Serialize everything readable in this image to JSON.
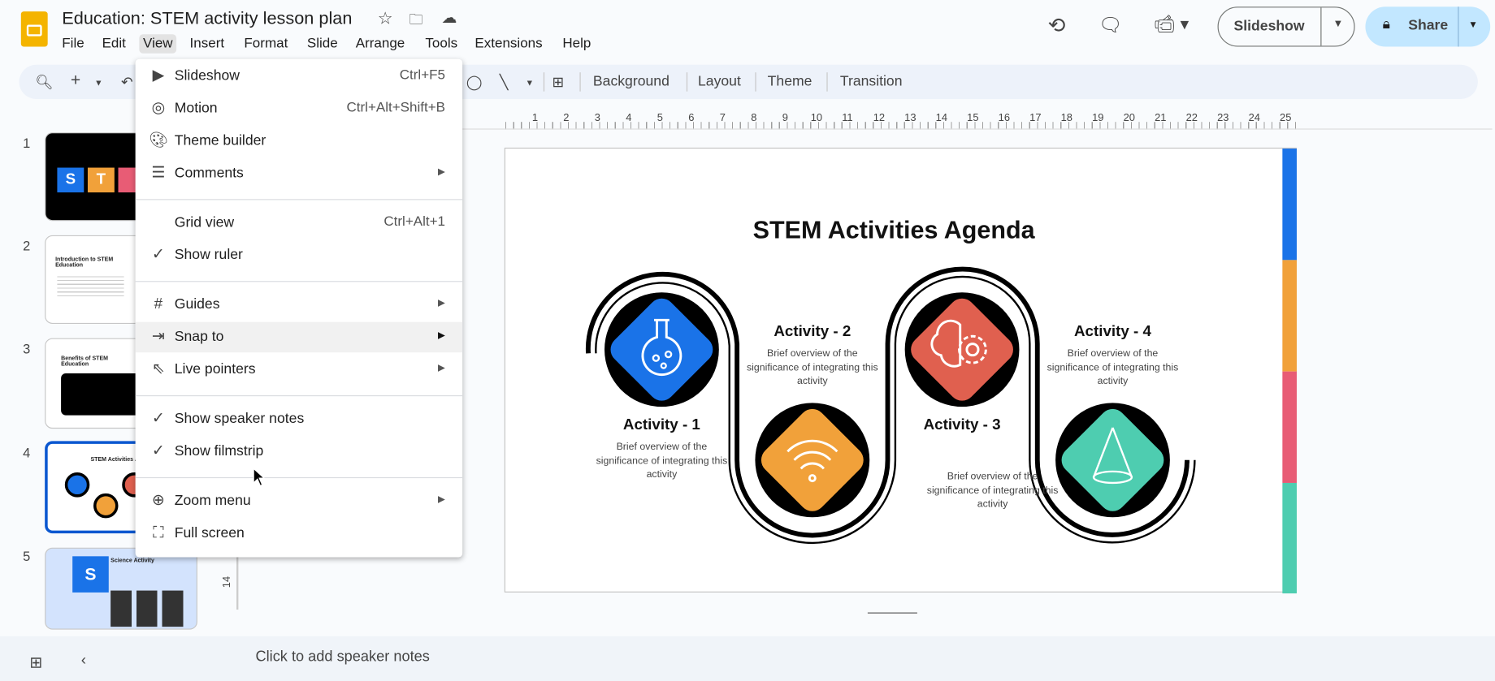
{
  "doc": {
    "title": "Education: STEM activity lesson plan"
  },
  "menubar": [
    "File",
    "Edit",
    "View",
    "Insert",
    "Format",
    "Slide",
    "Arrange",
    "Tools",
    "Extensions",
    "Help"
  ],
  "header": {
    "slideshow_label": "Slideshow",
    "share_label": "Share"
  },
  "toolbar": {
    "background": "Background",
    "layout": "Layout",
    "theme": "Theme",
    "transition": "Transition"
  },
  "view_menu": {
    "slideshow": {
      "label": "Slideshow",
      "shortcut": "Ctrl+F5"
    },
    "motion": {
      "label": "Motion",
      "shortcut": "Ctrl+Alt+Shift+B"
    },
    "theme_builder": {
      "label": "Theme builder"
    },
    "comments": {
      "label": "Comments"
    },
    "grid_view": {
      "label": "Grid view",
      "shortcut": "Ctrl+Alt+1"
    },
    "show_ruler": {
      "label": "Show ruler",
      "checked": true
    },
    "guides": {
      "label": "Guides"
    },
    "snap_to": {
      "label": "Snap to"
    },
    "live_pointers": {
      "label": "Live pointers"
    },
    "speaker_notes": {
      "label": "Show speaker notes",
      "checked": true
    },
    "filmstrip": {
      "label": "Show filmstrip",
      "checked": true
    },
    "zoom_menu": {
      "label": "Zoom menu"
    },
    "full_screen": {
      "label": "Full screen"
    }
  },
  "filmstrip": {
    "numbers": [
      "1",
      "2",
      "3",
      "4",
      "5"
    ],
    "selected": 4,
    "slide2_title": "Introduction to STEM Education",
    "slide3_title": "Benefits of STEM Education",
    "slide5_title": "Science Activity"
  },
  "ruler": {
    "h": [
      "1",
      "2",
      "3",
      "4",
      "5",
      "6",
      "7",
      "8",
      "9",
      "10",
      "11",
      "12",
      "13",
      "14",
      "15",
      "16",
      "17",
      "18",
      "19",
      "20",
      "21",
      "22",
      "23",
      "24",
      "25"
    ],
    "v": "14"
  },
  "slide": {
    "title": "STEM Activities Agenda",
    "activities": [
      {
        "title": "Activity - 1",
        "desc": "Brief overview of the significance of integrating this activity",
        "color": "#1a73e8"
      },
      {
        "title": "Activity - 2",
        "desc": "Brief overview of the significance of integrating this activity",
        "color": "#f1a13a"
      },
      {
        "title": "Activity - 3",
        "desc": "Brief overview of the significance of integrating this activity",
        "color": "#e0604f"
      },
      {
        "title": "Activity - 4",
        "desc": "Brief overview of the significance of integrating this activity",
        "color": "#4ecdb0"
      }
    ],
    "bar_colors": [
      "#1a73e8",
      "#f1a13a",
      "#e85c75",
      "#4ecdb0"
    ]
  },
  "notes": {
    "placeholder": "Click to add speaker notes"
  }
}
